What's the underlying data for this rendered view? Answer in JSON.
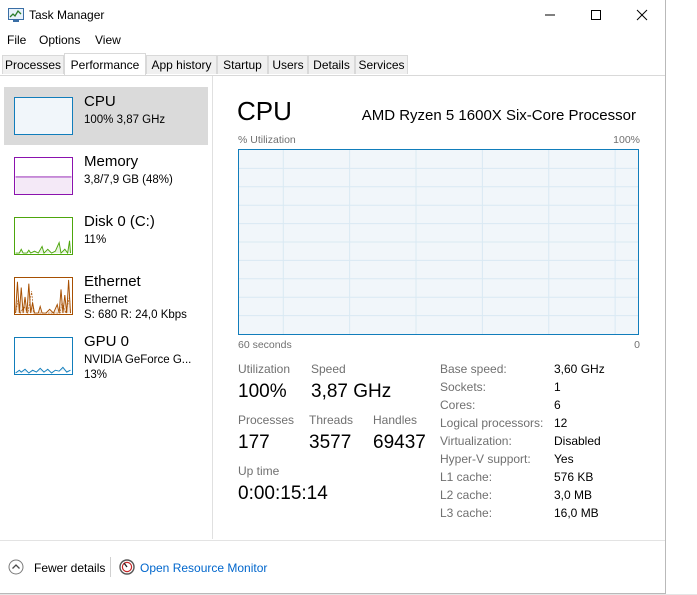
{
  "window": {
    "title": "Task Manager"
  },
  "menu": [
    "File",
    "Options",
    "View"
  ],
  "tabs": [
    "Processes",
    "Performance",
    "App history",
    "Startup",
    "Users",
    "Details",
    "Services"
  ],
  "active_tab": "Performance",
  "sidebar": [
    {
      "name": "CPU",
      "line1": "100%  3,87 GHz",
      "line2": "",
      "color": "#117dbb",
      "selected": true
    },
    {
      "name": "Memory",
      "line1": "3,8/7,9 GB (48%)",
      "line2": "",
      "color": "#8b12ae",
      "selected": false
    },
    {
      "name": "Disk 0 (C:)",
      "line1": "11%",
      "line2": "",
      "color": "#4da60c",
      "selected": false
    },
    {
      "name": "Ethernet",
      "line1": "Ethernet",
      "line2": "S: 680  R: 24,0 Kbps",
      "color": "#a74f01",
      "selected": false
    },
    {
      "name": "GPU 0",
      "line1": "NVIDIA GeForce G...",
      "line2": "13%",
      "color": "#117dbb",
      "selected": false
    }
  ],
  "detail": {
    "title": "CPU",
    "processor": "AMD Ryzen 5 1600X Six-Core Processor",
    "graph_label": "% Utilization",
    "graph_max": "100%",
    "axis_left": "60 seconds",
    "axis_right": "0",
    "utilization_label": "Utilization",
    "utilization": "100%",
    "speed_label": "Speed",
    "speed": "3,87 GHz",
    "processes_label": "Processes",
    "processes": "177",
    "threads_label": "Threads",
    "threads": "3577",
    "handles_label": "Handles",
    "handles": "69437",
    "uptime_label": "Up time",
    "uptime": "0:00:15:14",
    "specs": [
      {
        "label": "Base speed:",
        "value": "3,60 GHz"
      },
      {
        "label": "Sockets:",
        "value": "1"
      },
      {
        "label": "Cores:",
        "value": "6"
      },
      {
        "label": "Logical processors:",
        "value": "12"
      },
      {
        "label": "Virtualization:",
        "value": "Disabled"
      },
      {
        "label": "Hyper-V support:",
        "value": "Yes"
      },
      {
        "label": "L1 cache:",
        "value": "576 KB"
      },
      {
        "label": "L2 cache:",
        "value": "3,0 MB"
      },
      {
        "label": "L3 cache:",
        "value": "16,0 MB"
      }
    ]
  },
  "footer": {
    "fewer_details": "Fewer details",
    "open_resource_monitor": "Open Resource Monitor"
  },
  "colors": {
    "cpu": "#117dbb",
    "memory": "#8b12ae",
    "disk": "#4da60c",
    "ethernet": "#a74f01",
    "link": "#0066cc"
  }
}
